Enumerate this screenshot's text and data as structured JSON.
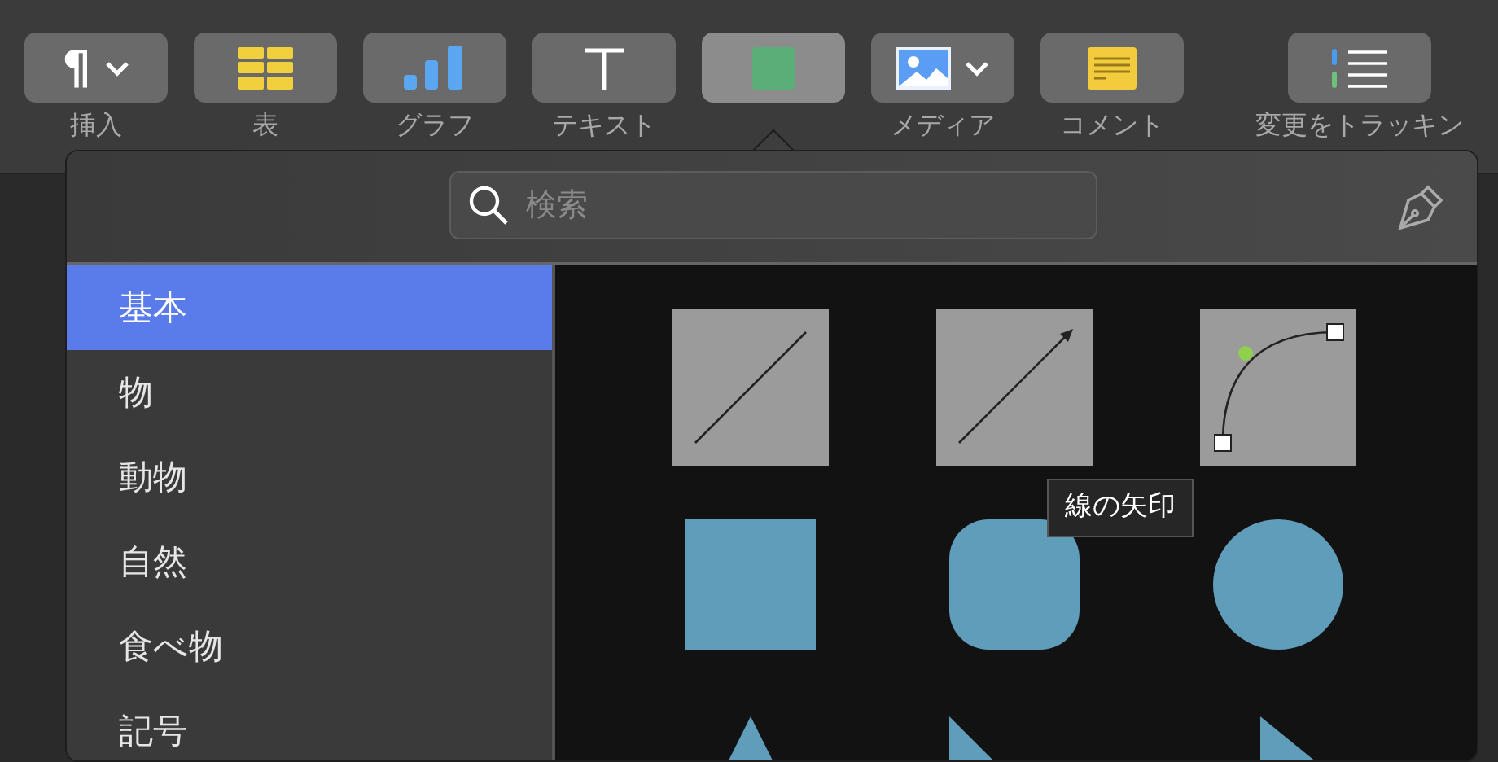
{
  "toolbar": [
    {
      "kind": "insert",
      "glyph": "¶",
      "label": "挿入",
      "menu": true,
      "selected": false
    },
    {
      "kind": "table",
      "label": "表",
      "menu": false,
      "selected": false
    },
    {
      "kind": "chart",
      "label": "グラフ",
      "menu": false,
      "selected": false
    },
    {
      "kind": "text",
      "label": "テキスト",
      "menu": false,
      "selected": false
    },
    {
      "kind": "shape",
      "menu": false,
      "selected": true
    },
    {
      "kind": "media",
      "label": "メディア",
      "menu": true,
      "selected": false
    },
    {
      "kind": "comment",
      "label": "コメント",
      "menu": false,
      "selected": false
    },
    {
      "kind": "track",
      "label": "変更をトラッキン",
      "menu": false,
      "selected": false
    }
  ],
  "popover": {
    "search": {
      "placeholder": "検索"
    },
    "categories": [
      {
        "label": "基本",
        "selected": true
      },
      {
        "label": "物",
        "selected": false
      },
      {
        "label": "動物",
        "selected": false
      },
      {
        "label": "自然",
        "selected": false
      },
      {
        "label": "食べ物",
        "selected": false
      },
      {
        "label": "記号",
        "selected": false
      }
    ],
    "shapes": [
      {
        "kind": "line"
      },
      {
        "kind": "arrow-line"
      },
      {
        "kind": "curve"
      },
      {
        "kind": "square"
      },
      {
        "kind": "rounded-square"
      },
      {
        "kind": "circle"
      },
      {
        "kind": "triangle"
      },
      {
        "kind": "right-triangle"
      },
      {
        "kind": "arrow"
      }
    ],
    "tooltip": "線の矢印"
  }
}
